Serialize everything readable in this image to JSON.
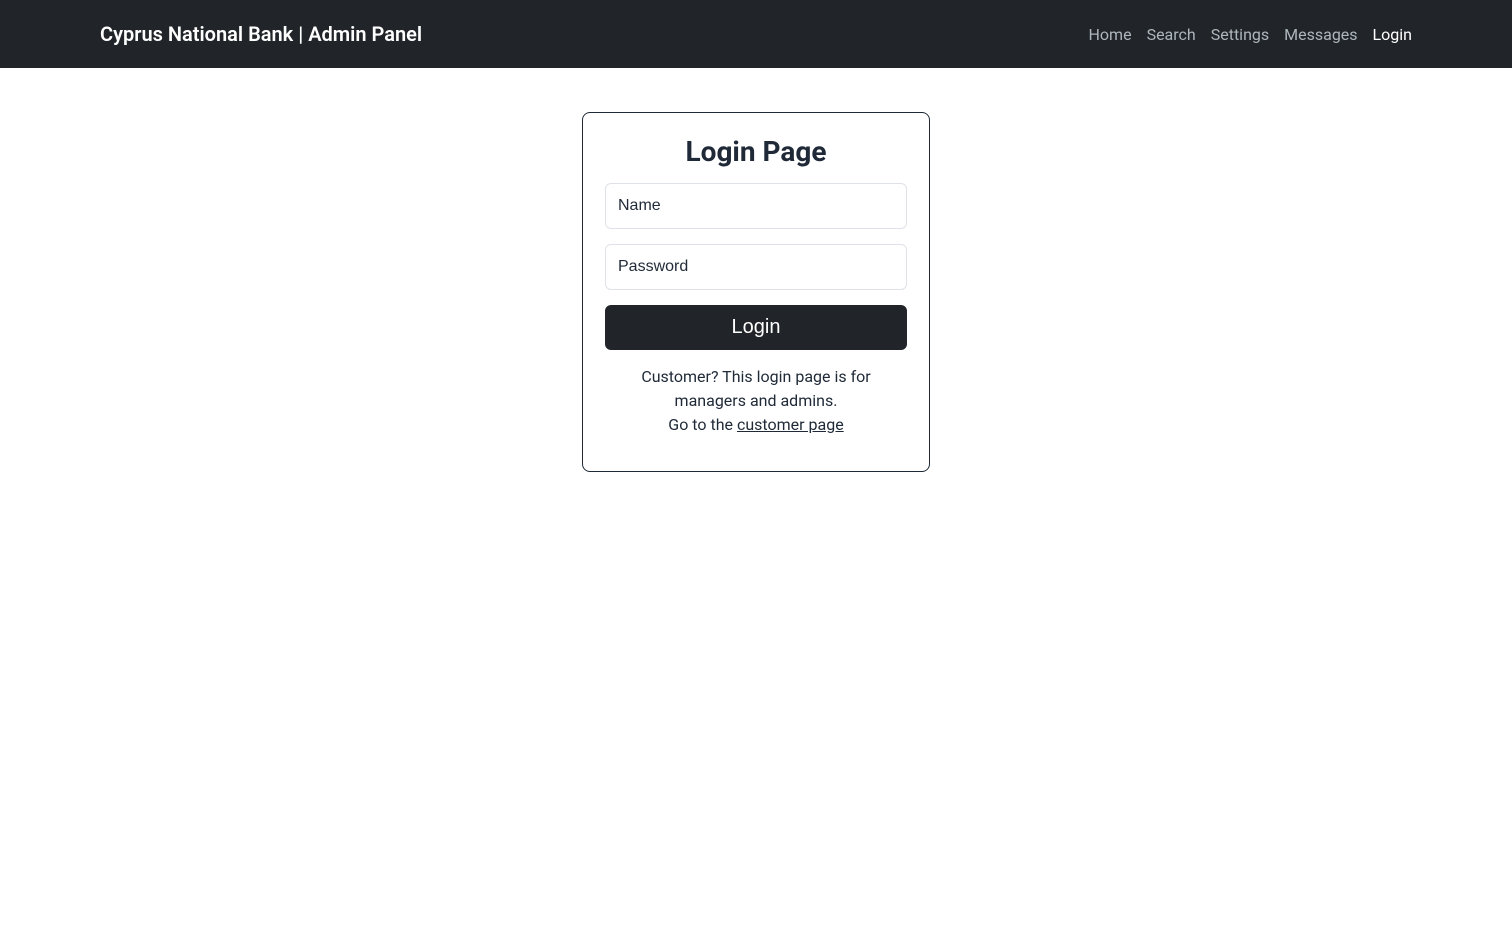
{
  "navbar": {
    "brand": "Cyprus National Bank | Admin Panel",
    "links": {
      "home": "Home",
      "search": "Search",
      "settings": "Settings",
      "messages": "Messages",
      "login": "Login"
    }
  },
  "login": {
    "title": "Login Page",
    "name_placeholder": "Name",
    "password_placeholder": "Password",
    "button_label": "Login",
    "info_line1": "Customer? This login page is for managers and admins.",
    "info_line2_prefix": "Go to the ",
    "info_link_text": "customer page"
  }
}
